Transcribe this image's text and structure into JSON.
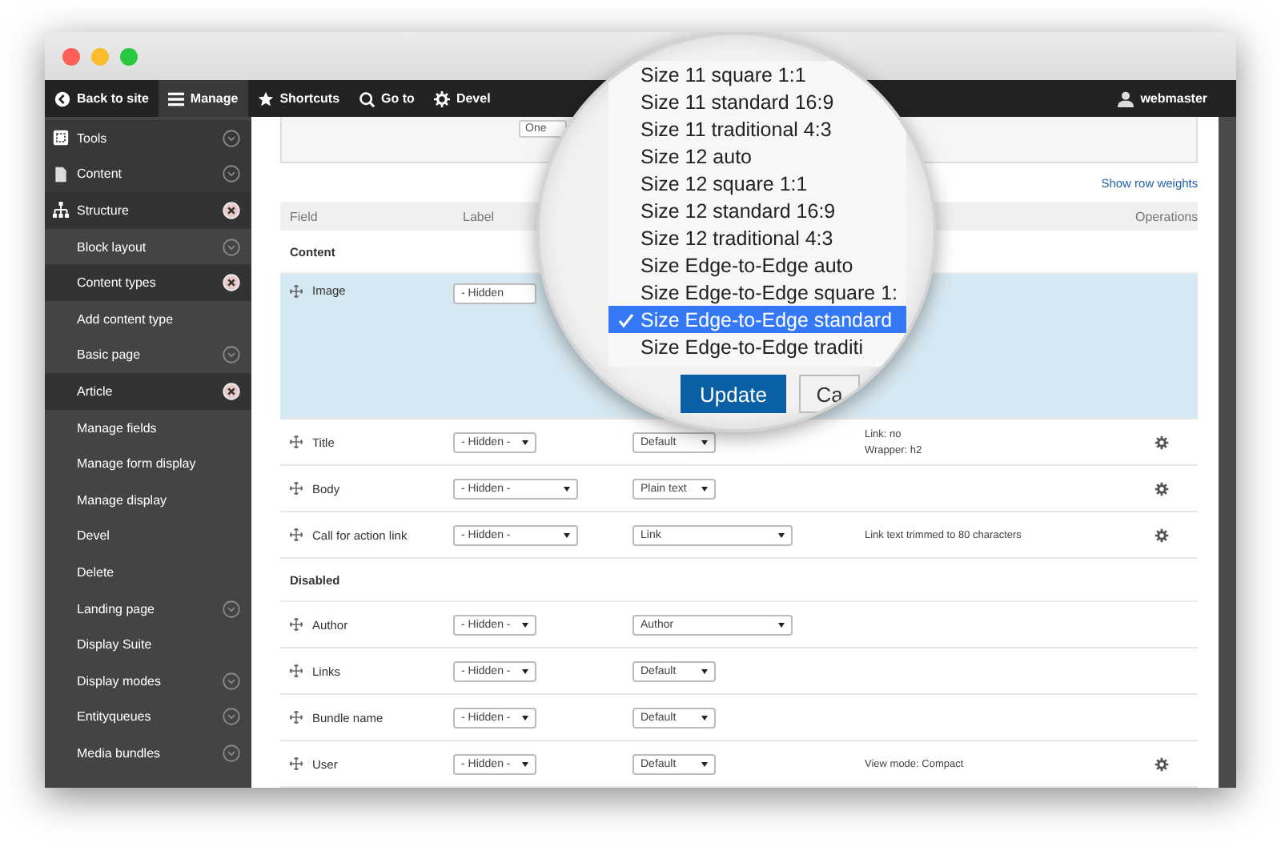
{
  "toolbar": {
    "items": [
      {
        "label": "Back to site",
        "selected": false
      },
      {
        "label": "Manage",
        "selected": true
      },
      {
        "label": "Shortcuts",
        "selected": false
      },
      {
        "label": "Go to",
        "selected": false
      },
      {
        "label": "Devel",
        "selected": false
      }
    ],
    "user": "webmaster"
  },
  "sidebar": {
    "items": [
      {
        "label": "Tools",
        "kind": "top",
        "expanded": false
      },
      {
        "label": "Content",
        "kind": "top",
        "expanded": false
      },
      {
        "label": "Structure",
        "kind": "top",
        "expanded": true
      },
      {
        "label": "Block layout",
        "kind": "sub",
        "expanded": false
      },
      {
        "label": "Content types",
        "kind": "sub",
        "expanded": true
      },
      {
        "label": "Add content type",
        "kind": "sub"
      },
      {
        "label": "Basic page",
        "kind": "sub",
        "expanded": false
      },
      {
        "label": "Article",
        "kind": "sub",
        "expanded": true
      },
      {
        "label": "Manage fields",
        "kind": "sub"
      },
      {
        "label": "Manage form display",
        "kind": "sub"
      },
      {
        "label": "Manage display",
        "kind": "sub"
      },
      {
        "label": "Devel",
        "kind": "sub"
      },
      {
        "label": "Delete",
        "kind": "sub"
      },
      {
        "label": "Landing page",
        "kind": "sub",
        "expanded": false
      },
      {
        "label": "Display Suite",
        "kind": "sub"
      },
      {
        "label": "Display modes",
        "kind": "sub",
        "expanded": false
      },
      {
        "label": "Entityqueues",
        "kind": "sub",
        "expanded": false
      },
      {
        "label": "Media bundles",
        "kind": "sub",
        "expanded": false
      }
    ]
  },
  "content": {
    "top_select": "One",
    "show_row_weights": "Show row weights",
    "header": {
      "field": "Field",
      "label": "Label",
      "operations": "Operations"
    },
    "rows": [
      {
        "kind": "section",
        "label": "Content"
      },
      {
        "kind": "field",
        "name": "Image",
        "expanded": true,
        "label_select": {
          "value": "- Hidden"
        },
        "settings": false
      },
      {
        "kind": "field",
        "name": "Title",
        "expanded": false,
        "label_select": {
          "value": "- Hidden -",
          "wide": false
        },
        "format_select": {
          "value": "Default",
          "wide": false
        },
        "summary": [
          "Link: no",
          "Wrapper: h2"
        ],
        "settings": true
      },
      {
        "kind": "field",
        "name": "Body",
        "expanded": false,
        "label_select": {
          "value": "- Hidden -",
          "wide": true
        },
        "format_select": {
          "value": "Plain text",
          "wide": false
        },
        "settings": true
      },
      {
        "kind": "field",
        "name": "Call for action link",
        "expanded": false,
        "label_select": {
          "value": "- Hidden -",
          "wide": true
        },
        "format_select": {
          "value": "Link",
          "wide": true
        },
        "summary": [
          "Link text trimmed to 80 characters"
        ],
        "settings": true
      },
      {
        "kind": "section",
        "label": "Disabled"
      },
      {
        "kind": "field",
        "name": "Author",
        "expanded": false,
        "label_select": {
          "value": "- Hidden -",
          "wide": false
        },
        "format_select": {
          "value": "Author",
          "wide": true
        },
        "settings": false
      },
      {
        "kind": "field",
        "name": "Links",
        "expanded": false,
        "label_select": {
          "value": "- Hidden -",
          "wide": false
        },
        "format_select": {
          "value": "Default",
          "wide": false
        },
        "settings": false
      },
      {
        "kind": "field",
        "name": "Bundle name",
        "expanded": false,
        "label_select": {
          "value": "- Hidden -",
          "wide": false
        },
        "format_select": {
          "value": "Default",
          "wide": false
        },
        "settings": false
      },
      {
        "kind": "field",
        "name": "User",
        "expanded": false,
        "label_select": {
          "value": "- Hidden -",
          "wide": false
        },
        "format_select": {
          "value": "Default",
          "wide": false
        },
        "summary": [
          "View mode: Compact"
        ],
        "settings": true
      }
    ]
  },
  "magnifier": {
    "options": [
      {
        "label": "Size 11 square 1:1",
        "selected": false
      },
      {
        "label": "Size 11 standard 16:9",
        "selected": false
      },
      {
        "label": "Size 11 traditional 4:3",
        "selected": false
      },
      {
        "label": "Size 12 auto",
        "selected": false
      },
      {
        "label": "Size 12 square 1:1",
        "selected": false
      },
      {
        "label": "Size 12 standard 16:9",
        "selected": false
      },
      {
        "label": "Size 12 traditional 4:3",
        "selected": false
      },
      {
        "label": "Size Edge-to-Edge auto",
        "selected": false
      },
      {
        "label": "Size Edge-to-Edge square 1:",
        "selected": false
      },
      {
        "label": "Size Edge-to-Edge standard",
        "selected": true
      },
      {
        "label": "Size Edge-to-Edge traditi",
        "selected": false
      }
    ],
    "update_button": "Update",
    "cancel_button": "Ca"
  }
}
